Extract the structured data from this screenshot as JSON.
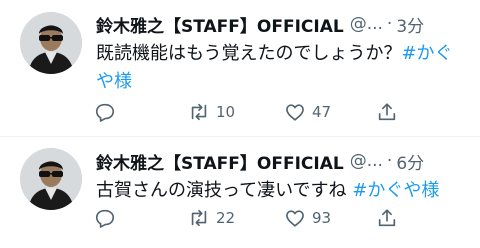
{
  "colors": {
    "hashtag": "#1d9bf0",
    "muted": "#536471",
    "text": "#0f1419",
    "divider": "#eff3f4"
  },
  "tweets": [
    {
      "name": "鈴木雅之【STAFF】OFFICIAL",
      "handle": "@...",
      "dot": "·",
      "time": "3分",
      "text_main": "既読機能はもう覚えたのでしょうか？",
      "hashtag": "#かぐや様",
      "icons": {
        "reply": "reply-icon",
        "retweet": "retweet-icon",
        "like": "heart-icon",
        "share": "share-icon"
      },
      "retweets": "10",
      "likes": "47"
    },
    {
      "name": "鈴木雅之【STAFF】OFFICIAL",
      "handle": "@...",
      "dot": "·",
      "time": "6分",
      "text_main": "古賀さんの演技って凄いですね",
      "hashtag": "#かぐや様",
      "icons": {
        "reply": "reply-icon",
        "retweet": "retweet-icon",
        "like": "heart-icon",
        "share": "share-icon"
      },
      "retweets": "22",
      "likes": "93"
    }
  ]
}
